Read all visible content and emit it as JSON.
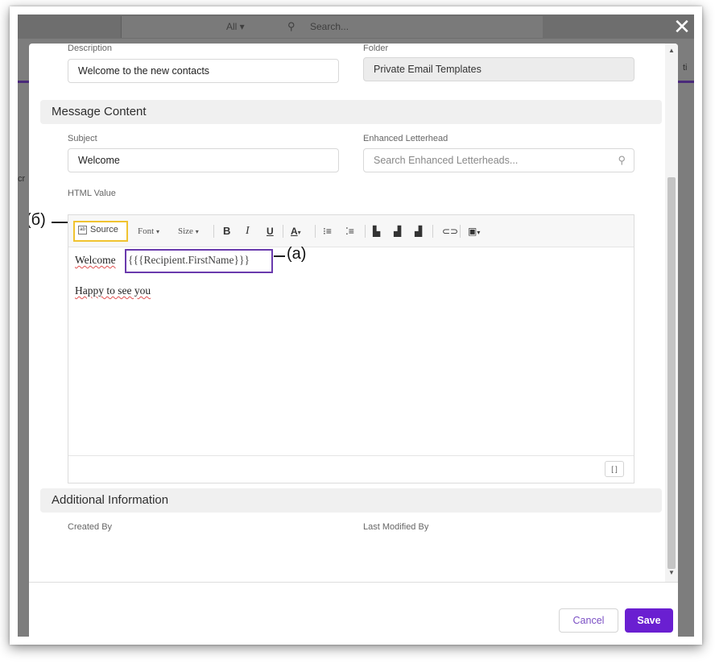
{
  "background": {
    "scope": "All",
    "search_placeholder": "Search...",
    "fragment_left": "cr",
    "fragment_right": "ti"
  },
  "close_label": "✕",
  "details": {
    "description_label": "Description",
    "description_value": "Welcome to the new contacts",
    "folder_label": "Folder",
    "folder_value": "Private Email Templates"
  },
  "message_content": {
    "section_title": "Message Content",
    "subject_label": "Subject",
    "subject_value": "Welcome",
    "letterhead_label": "Enhanced Letterhead",
    "letterhead_placeholder": "Search Enhanced Letterheads...",
    "html_label": "HTML Value"
  },
  "toolbar": {
    "source_label": "Source",
    "font_label": "Font",
    "size_label": "Size",
    "bold": "B",
    "italic": "I",
    "underline": "U",
    "text_color": "A"
  },
  "editor": {
    "line1_word": "Welcome",
    "merge_field": "{{{Recipient.FirstName}}}",
    "line2": "Happy to see you",
    "resize_label": "[ ]"
  },
  "annotations": {
    "source_callout": "(б)",
    "merge_callout": "(a)"
  },
  "additional": {
    "section_title": "Additional Information",
    "created_by_label": "Created By",
    "last_modified_label": "Last Modified By"
  },
  "footer": {
    "cancel_label": "Cancel",
    "save_label": "Save"
  },
  "colors": {
    "brand_purple": "#6a1fd1",
    "merge_highlight": "#6a3aad",
    "source_highlight": "#f0c330"
  }
}
